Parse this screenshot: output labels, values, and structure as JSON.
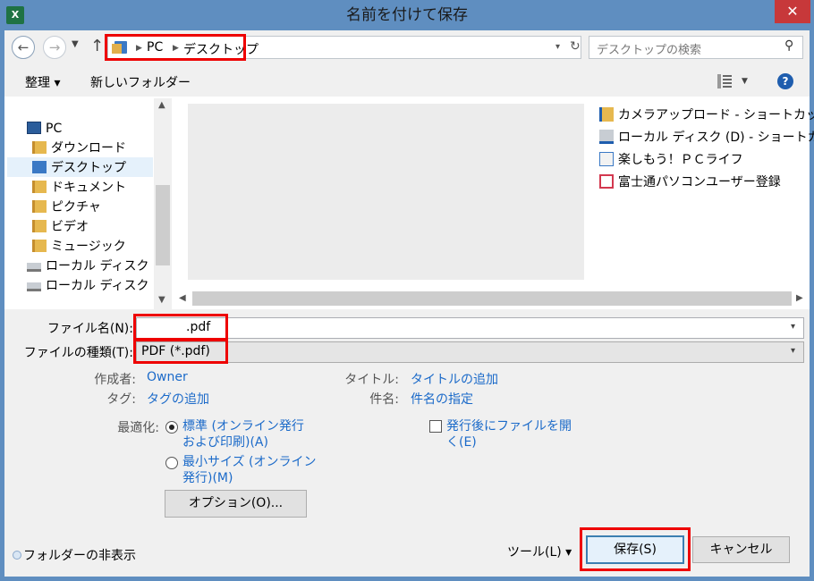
{
  "window": {
    "title": "名前を付けて保存",
    "app_icon_label": "X"
  },
  "nav": {
    "breadcrumbs": [
      "PC",
      "デスクトップ"
    ],
    "search_placeholder": "デスクトップの検索"
  },
  "toolbar": {
    "organize": "整理 ▾",
    "new_folder": "新しいフォルダー"
  },
  "tree": {
    "items": [
      {
        "label": "PC",
        "icon": "pc-icon"
      },
      {
        "label": "ダウンロード",
        "icon": "downloads-folder-icon"
      },
      {
        "label": "デスクトップ",
        "icon": "desktop-folder-icon",
        "selected": true
      },
      {
        "label": "ドキュメント",
        "icon": "documents-folder-icon"
      },
      {
        "label": "ピクチャ",
        "icon": "pictures-folder-icon"
      },
      {
        "label": "ビデオ",
        "icon": "videos-folder-icon"
      },
      {
        "label": "ミュージック",
        "icon": "music-folder-icon"
      },
      {
        "label": "ローカル ディスク (C:",
        "icon": "drive-c-icon"
      },
      {
        "label": "ローカル ディスク (D:",
        "icon": "drive-d-icon"
      }
    ]
  },
  "files": [
    {
      "label": "カメラアップロード - ショートカット"
    },
    {
      "label": "ローカル ディスク (D) - ショートカット"
    },
    {
      "label": "楽しもう！ＰＣライフ"
    },
    {
      "label": "富士通パソコンユーザー登録"
    }
  ],
  "form": {
    "filename_label": "ファイル名(N):",
    "filename_value": ".pdf",
    "filetype_label": "ファイルの種類(T):",
    "filetype_value": "PDF (*.pdf)",
    "author_label": "作成者:",
    "author_value": "Owner",
    "tags_label": "タグ:",
    "tags_value": "タグの追加",
    "title_label": "タイトル:",
    "title_value": "タイトルの追加",
    "subject_label": "件名:",
    "subject_value": "件名の指定",
    "optimize_label": "最適化:",
    "radio_standard": "標準 (オンライン発行および印刷)(A)",
    "radio_minimum": "最小サイズ (オンライン発行)(M)",
    "options_button": "オプション(O)...",
    "open_after_label": "発行後にファイルを開く(E)"
  },
  "footer": {
    "hide_folders": "フォルダーの非表示",
    "tools": "ツール(L) ▾",
    "save": "保存(S)",
    "cancel": "キャンセル"
  },
  "colors": {
    "titlebar": "#5f8ec0",
    "highlight": "#e00000",
    "link": "#1b6ac9"
  }
}
